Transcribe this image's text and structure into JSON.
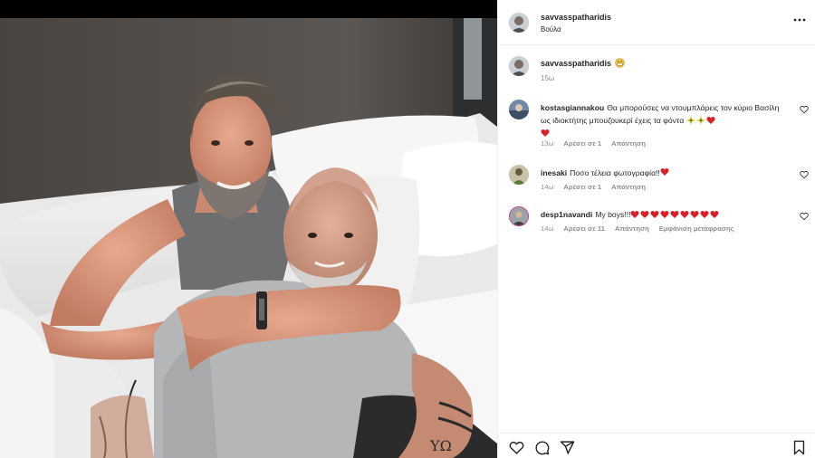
{
  "post": {
    "username": "savvasspatharidis",
    "location": "Βούλα",
    "caption_time": "15ω"
  },
  "comments": [
    {
      "username": "kostasgiannakou",
      "text": "Θα μπορούσες να ντουμπλάρεις τον κύριο Βασίλη ως ιδιοκτήτης μπουζουκερί έχεις τα φόντα",
      "time": "13ω",
      "likes": "Αρέσει σε 1",
      "reply": "Απάντηση",
      "emojis": [
        "star",
        "star",
        "heart",
        "heart"
      ]
    },
    {
      "username": "inesaki",
      "text": "Ποσο τέλεια φωτογραφία!!",
      "time": "14ω",
      "likes": "Αρέσει σε 1",
      "reply": "Απάντηση",
      "emojis": [
        "heart"
      ]
    },
    {
      "username": "desp1navandi",
      "text": "My boys!!!",
      "time": "14ω",
      "likes": "Αρέσει σε 11",
      "reply": "Απάντηση",
      "translate": "Εμφάνιση μετάφρασης",
      "emojis": [
        "heart",
        "heart",
        "heart",
        "heart",
        "heart",
        "heart",
        "heart",
        "heart",
        "heart"
      ]
    }
  ],
  "icons": {
    "more": "more-options-icon",
    "like": "heart-icon",
    "comment": "comment-icon",
    "share": "share-icon",
    "save": "bookmark-icon"
  },
  "colors": {
    "heart": "#e0245e",
    "muted": "#8e8e8e",
    "text": "#262626"
  }
}
